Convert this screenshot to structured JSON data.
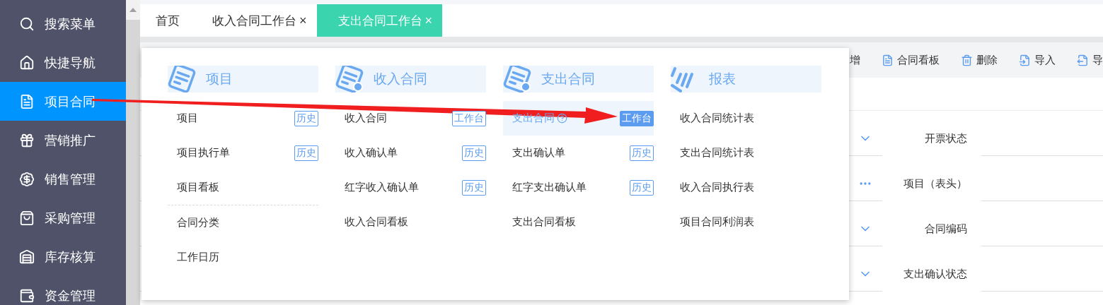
{
  "sidebar": {
    "items": [
      {
        "label": "搜索菜单",
        "selected": false
      },
      {
        "label": "快捷导航",
        "selected": false
      },
      {
        "label": "项目合同",
        "selected": true
      },
      {
        "label": "营销推广",
        "selected": false
      },
      {
        "label": "销售管理",
        "selected": false
      },
      {
        "label": "采购管理",
        "selected": false
      },
      {
        "label": "库存核算",
        "selected": false
      },
      {
        "label": "资金管理",
        "selected": false
      }
    ]
  },
  "tabs": [
    {
      "label": "首页",
      "selected": false
    },
    {
      "label": "收入合同工作台",
      "close": "×",
      "selected": false
    },
    {
      "label": "支出合同工作台",
      "close": "×",
      "selected": true
    }
  ],
  "toolbar": [
    "增",
    "合同看板",
    "删除",
    "导入",
    "导"
  ],
  "form": [
    {
      "kind": "select",
      "label": "开票状态"
    },
    {
      "kind": "lookup",
      "label": "项目（表头）"
    },
    {
      "kind": "select",
      "label": "合同编码"
    },
    {
      "kind": "select",
      "label": "支出确认状态"
    }
  ],
  "menu": {
    "columns": [
      {
        "title": "项目",
        "groups": [
          [
            {
              "label": "项目",
              "badge": "历史",
              "selected": false
            },
            {
              "label": "项目执行单",
              "badge": "历史",
              "selected": false
            },
            {
              "label": "项目看板",
              "selected": false
            }
          ],
          [
            {
              "label": "合同分类",
              "selected": false
            },
            {
              "label": "工作日历",
              "selected": false
            }
          ]
        ]
      },
      {
        "title": "收入合同",
        "groups": [
          [
            {
              "label": "收入合同",
              "badge": "工作台",
              "selected": false
            },
            {
              "label": "收入确认单",
              "badge": "历史",
              "selected": false
            },
            {
              "label": "红字收入确认单",
              "badge": "历史",
              "selected": false
            },
            {
              "label": "收入合同看板",
              "selected": false
            }
          ]
        ]
      },
      {
        "title": "支出合同",
        "groups": [
          [
            {
              "label": "支出合同",
              "badge": "工作台",
              "selected": true
            },
            {
              "label": "支出确认单",
              "badge": "历史",
              "selected": false
            },
            {
              "label": "红字支出确认单",
              "badge": "历史",
              "selected": false
            },
            {
              "label": "支出合同看板",
              "selected": false
            }
          ]
        ]
      },
      {
        "title": "报表",
        "groups": [
          [
            {
              "label": "收入合同统计表",
              "selected": false
            },
            {
              "label": "支出合同统计表",
              "selected": false
            },
            {
              "label": "收入合同执行表",
              "selected": false
            },
            {
              "label": "项目合同利润表",
              "selected": false
            }
          ]
        ]
      }
    ]
  }
}
